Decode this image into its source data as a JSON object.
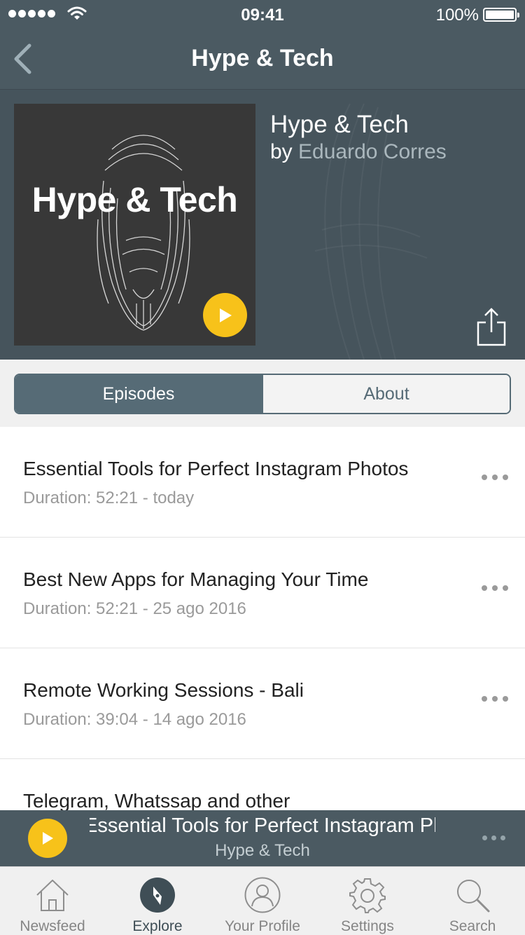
{
  "status_bar": {
    "time": "09:41",
    "battery": "100%"
  },
  "nav": {
    "title": "Hype & Tech",
    "back_icon": "chevron-left-icon"
  },
  "podcast": {
    "cover_title": "Hype & Tech",
    "title": "Hype & Tech",
    "by": "by",
    "author": "Eduardo Corres"
  },
  "tabs_segment": {
    "episodes": "Episodes",
    "about": "About",
    "selected": "episodes"
  },
  "episodes": [
    {
      "title": "Essential Tools for Perfect Instagram Photos",
      "meta": "Duration: 52:21 - today"
    },
    {
      "title": "Best New Apps for Managing Your Time",
      "meta": "Duration: 52:21 - 25 ago 2016"
    },
    {
      "title": "Remote Working Sessions - Bali",
      "meta": "Duration: 39:04 - 14 ago 2016"
    },
    {
      "title": "Telegram, Whatssap and other",
      "meta": ""
    }
  ],
  "mini_player": {
    "title": "Essential Tools for Perfect Instagram Photos",
    "subtitle": "Hype & Tech"
  },
  "tab_bar": [
    {
      "label": "Newsfeed",
      "icon": "home-icon"
    },
    {
      "label": "Explore",
      "icon": "compass-icon"
    },
    {
      "label": "Your Profile",
      "icon": "user-icon"
    },
    {
      "label": "Settings",
      "icon": "gear-icon"
    },
    {
      "label": "Search",
      "icon": "search-icon"
    }
  ],
  "colors": {
    "header": "#4b5a62",
    "accent": "#f7c21a",
    "segment": "#566b76"
  }
}
